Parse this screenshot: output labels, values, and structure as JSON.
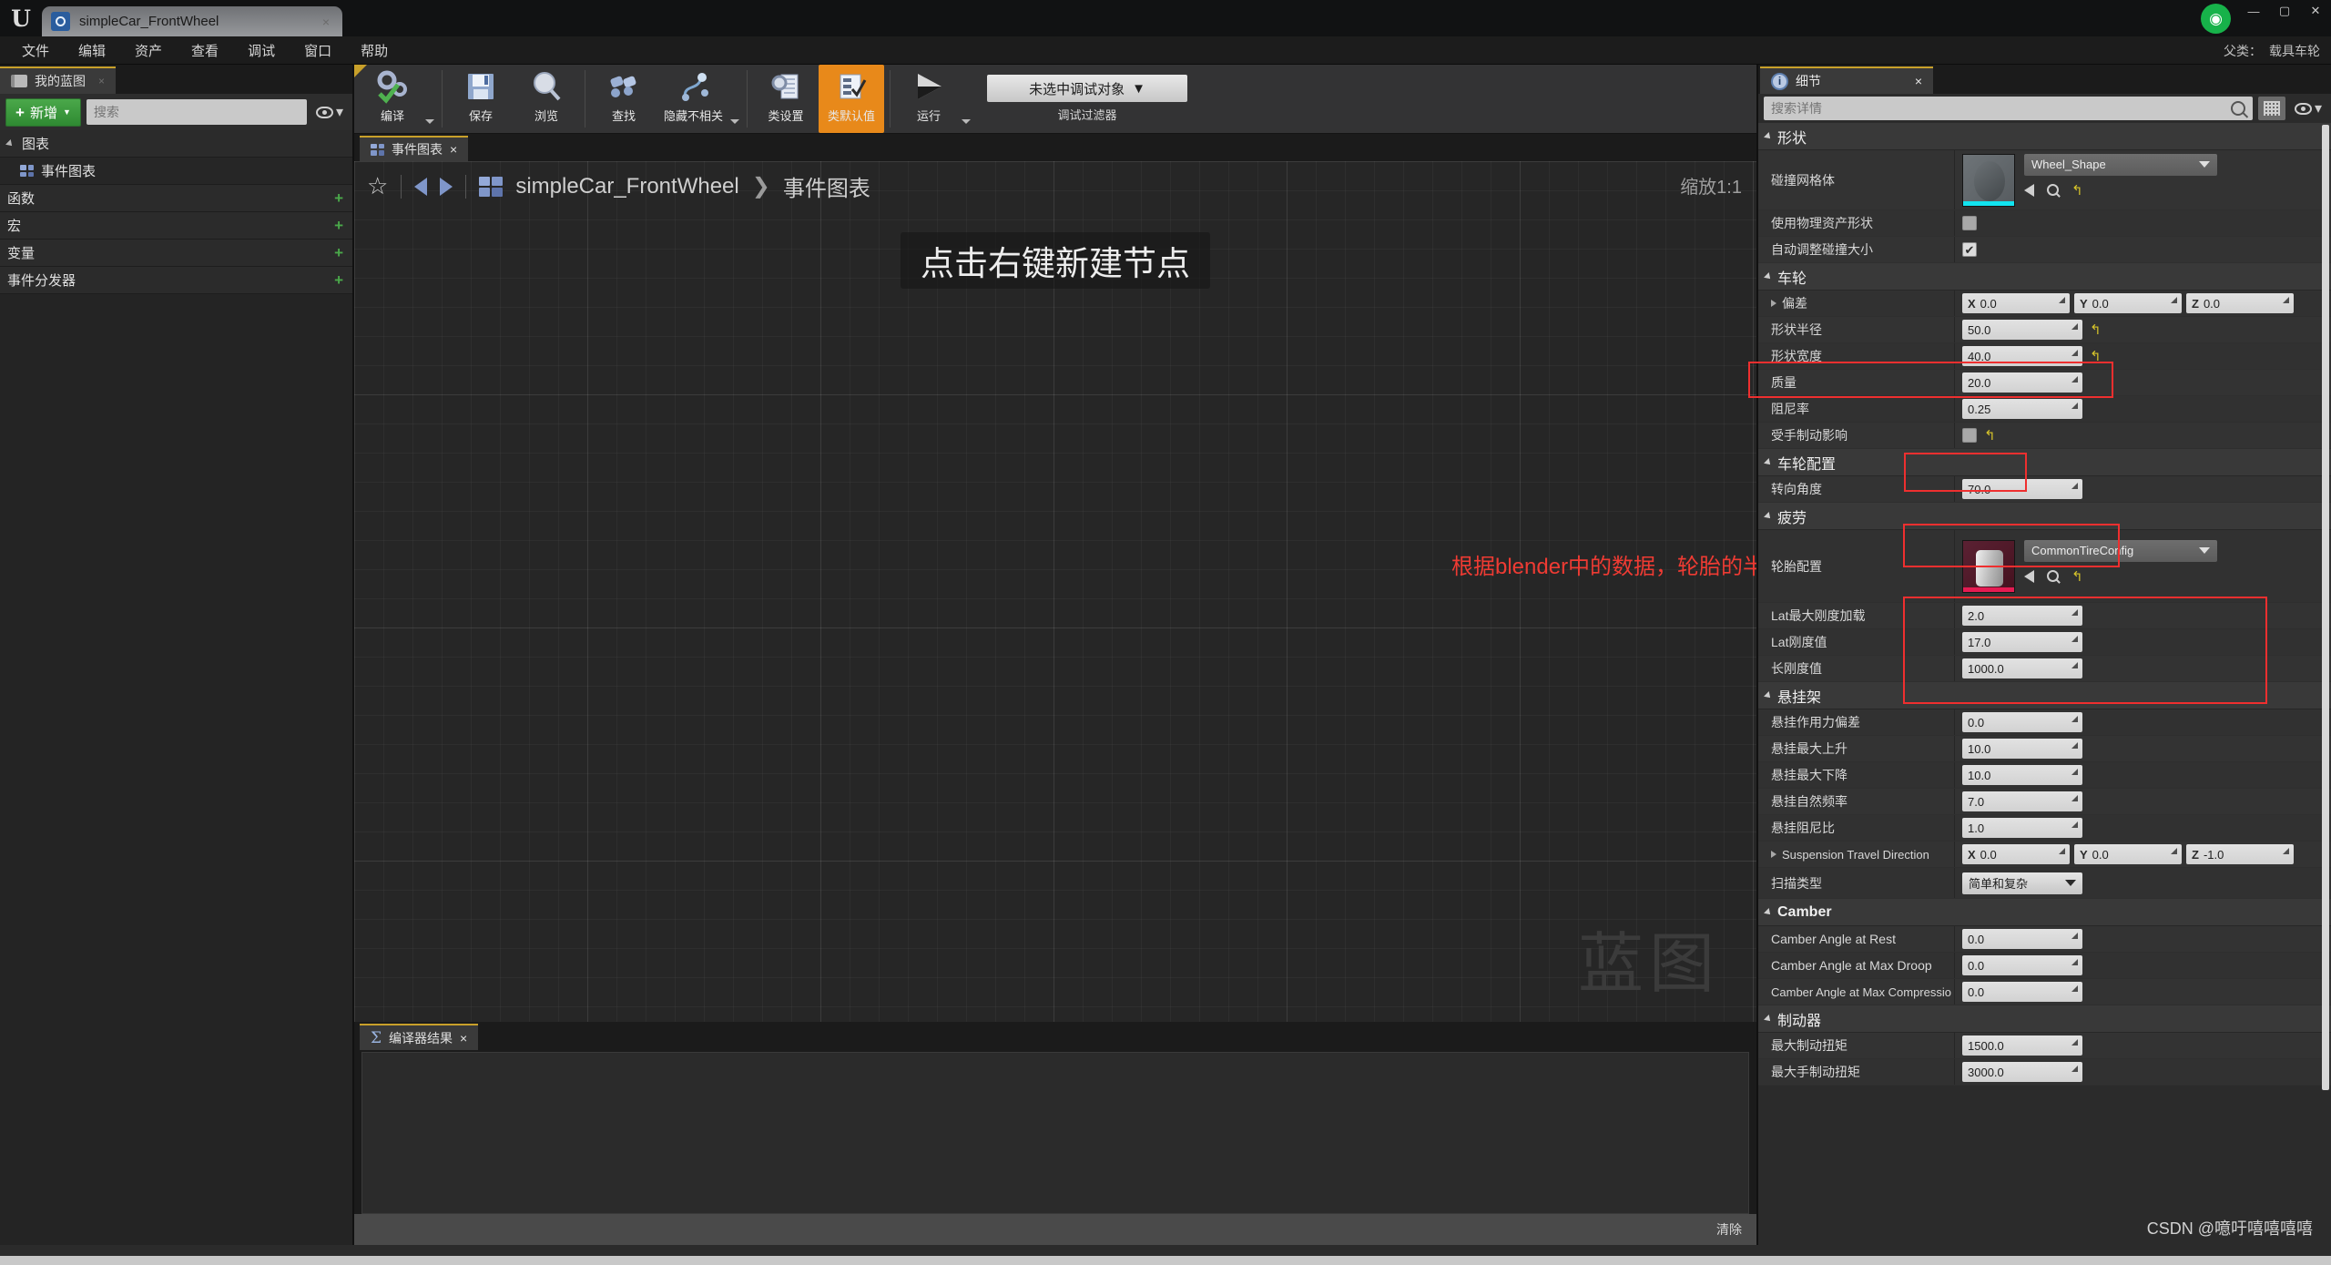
{
  "window": {
    "tab_title": "simpleCar_FrontWheel",
    "tab_close": "×",
    "logo": "ue-logo",
    "minimize": "—",
    "maximize": "▢",
    "close": "✕",
    "badge_icon": "unreal-badge"
  },
  "menubar": {
    "items": [
      "文件",
      "编辑",
      "资产",
      "查看",
      "调试",
      "窗口",
      "帮助"
    ],
    "right_label": "父类：",
    "right_value": "载具车轮"
  },
  "left_panel": {
    "tab_label": "我的蓝图",
    "tab_close": "×",
    "add_button": "新增",
    "add_caret": "▼",
    "search_placeholder": "搜索",
    "search_value": "",
    "items": [
      {
        "label": "图表",
        "type": "category",
        "expandable": true,
        "plus": false
      },
      {
        "label": "事件图表",
        "type": "item",
        "expandable": false,
        "plus": false
      },
      {
        "label": "函数",
        "type": "category",
        "expandable": false,
        "plus": true
      },
      {
        "label": "宏",
        "type": "category",
        "expandable": false,
        "plus": true
      },
      {
        "label": "变量",
        "type": "category",
        "expandable": false,
        "plus": true
      },
      {
        "label": "事件分发器",
        "type": "category",
        "expandable": false,
        "plus": true
      }
    ]
  },
  "toolbar": {
    "groups": [
      {
        "items": [
          {
            "label": "编译",
            "icon": "compile-icon",
            "caret": true,
            "active": false
          }
        ]
      },
      {
        "items": [
          {
            "label": "保存",
            "icon": "save-icon",
            "caret": false,
            "active": false
          },
          {
            "label": "浏览",
            "icon": "browse-icon",
            "caret": false,
            "active": false
          }
        ]
      },
      {
        "items": [
          {
            "label": "查找",
            "icon": "find-icon",
            "caret": false,
            "active": false
          },
          {
            "label": "隐藏不相关",
            "icon": "hide-unrelated-icon",
            "caret": true,
            "active": false
          }
        ]
      },
      {
        "items": [
          {
            "label": "类设置",
            "icon": "class-settings-icon",
            "caret": false,
            "active": false
          },
          {
            "label": "类默认值",
            "icon": "class-defaults-icon",
            "caret": false,
            "active": true
          }
        ]
      },
      {
        "items": [
          {
            "label": "运行",
            "icon": "play-icon",
            "caret": true,
            "active": false
          }
        ]
      }
    ],
    "debug_object": "未选中调试对象",
    "debug_caret": "▼",
    "debug_caption": "调试过滤器"
  },
  "graph": {
    "tab_label": "事件图表",
    "tab_close": "×",
    "breadcrumb_root": "simpleCar_FrontWheel",
    "breadcrumb_sep": "❯",
    "breadcrumb_leaf": "事件图表",
    "zoom_label": "缩放1:1",
    "hint": "点击右键新建节点",
    "watermark": "蓝图",
    "annotation": "根据blender中的数据，轮胎的半径和宽度",
    "annotation_color": "#ef3b33"
  },
  "results": {
    "tab_label": "编译器结果",
    "tab_close": "×",
    "clear_label": "清除",
    "content": ""
  },
  "details": {
    "tab_label": "细节",
    "tab_close": "×",
    "search_placeholder": "搜索详情",
    "search_value": "",
    "sections": [
      {
        "title": "形状",
        "english": false,
        "rows": [
          {
            "name": "碰撞网格体",
            "type": "asset",
            "value": "Wheel_Shape",
            "thumb": "wheel-shape-thumb"
          },
          {
            "name": "使用物理资产形状",
            "type": "checkbox",
            "checked": false
          },
          {
            "name": "自动调整碰撞大小",
            "type": "checkbox",
            "checked": true
          }
        ]
      },
      {
        "title": "车轮",
        "english": false,
        "rows": [
          {
            "name": "偏差",
            "type": "vector",
            "expandable": true,
            "x": "0.0",
            "y": "0.0",
            "z": "0.0"
          },
          {
            "name": "形状半径",
            "type": "number",
            "value": "50.0",
            "reset": true
          },
          {
            "name": "形状宽度",
            "type": "number",
            "value": "40.0",
            "reset": true
          },
          {
            "name": "质量",
            "type": "number",
            "value": "20.0"
          },
          {
            "name": "阻尼率",
            "type": "number",
            "value": "0.25"
          },
          {
            "name": "受手制动影响",
            "type": "checkbox",
            "checked": false,
            "reset": true
          }
        ]
      },
      {
        "title": "车轮配置",
        "english": false,
        "rows": [
          {
            "name": "转向角度",
            "type": "number",
            "value": "70.0"
          }
        ]
      },
      {
        "title": "疲劳",
        "english": false,
        "rows": [
          {
            "name": "轮胎配置",
            "type": "asset",
            "value": "CommonTireConfig",
            "thumb": "tire-config-thumb"
          },
          {
            "name": "Lat最大刚度加载",
            "type": "number",
            "value": "2.0"
          },
          {
            "name": "Lat刚度值",
            "type": "number",
            "value": "17.0"
          },
          {
            "name": "长刚度值",
            "type": "number",
            "value": "1000.0"
          }
        ]
      },
      {
        "title": "悬挂架",
        "english": false,
        "rows": [
          {
            "name": "悬挂作用力偏差",
            "type": "number",
            "value": "0.0"
          },
          {
            "name": "悬挂最大上升",
            "type": "number",
            "value": "10.0"
          },
          {
            "name": "悬挂最大下降",
            "type": "number",
            "value": "10.0"
          },
          {
            "name": "悬挂自然频率",
            "type": "number",
            "value": "7.0"
          },
          {
            "name": "悬挂阻尼比",
            "type": "number",
            "value": "1.0"
          },
          {
            "name": "Suspension Travel Direction",
            "type": "vector",
            "expandable": true,
            "x": "0.0",
            "y": "0.0",
            "z": "-1.0"
          },
          {
            "name": "扫描类型",
            "type": "combo",
            "value": "简单和复杂"
          }
        ]
      },
      {
        "title": "Camber",
        "english": true,
        "rows": [
          {
            "name": "Camber Angle at Rest",
            "type": "number",
            "value": "0.0"
          },
          {
            "name": "Camber Angle at Max Droop",
            "type": "number",
            "value": "0.0"
          },
          {
            "name": "Camber Angle at Max Compressio",
            "type": "number",
            "value": "0.0"
          }
        ]
      },
      {
        "title": "制动器",
        "english": false,
        "rows": [
          {
            "name": "最大制动扭矩",
            "type": "number",
            "value": "1500.0"
          },
          {
            "name": "最大手制动扭矩",
            "type": "number",
            "value": "3000.0"
          }
        ]
      }
    ]
  },
  "watermark_csdn": "CSDN @噫吁嘻嘻嘻嘻"
}
